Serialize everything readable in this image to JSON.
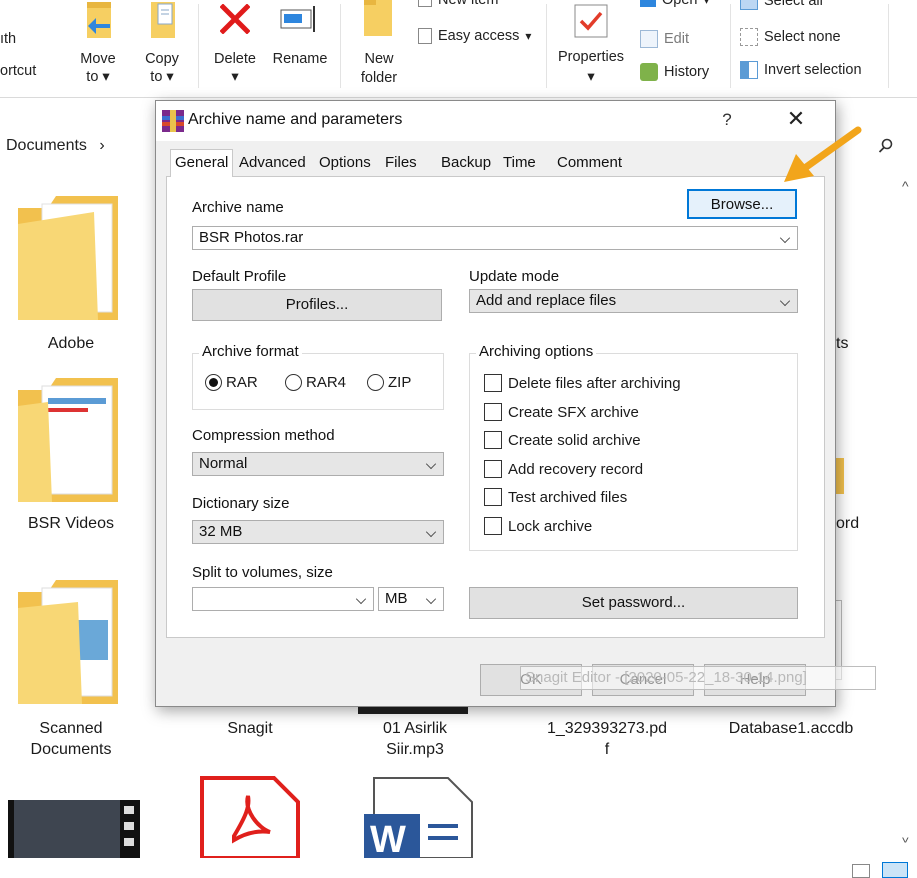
{
  "ribbon": {
    "path_label": "ıth",
    "shortcut_label": "ortcut",
    "move_to": [
      "Move",
      "to"
    ],
    "copy_to": [
      "Copy",
      "to"
    ],
    "delete": "Delete",
    "rename": "Rename",
    "new_folder": [
      "New",
      "folder"
    ],
    "new_item": "New item",
    "easy_access": "Easy access",
    "properties": "Properties",
    "open": "Open",
    "edit": "Edit",
    "history": "History",
    "select_all": "Select all",
    "select_none": "Select none",
    "invert_selection": "Invert selection"
  },
  "address": {
    "crumb": "Documents",
    "chevron": "›"
  },
  "files": {
    "adobe": "Adobe",
    "bsr_videos": "BSR Videos",
    "scanned": [
      "Scanned",
      "Documents"
    ],
    "snagit": "Snagit",
    "mp3": [
      "01 Asirlik",
      "Siir.mp3"
    ],
    "pdf": [
      "1_329393273.pd",
      "f"
    ],
    "accdb": "Database1.accdb",
    "partial_ts": "ts",
    "partial_ord": "ord"
  },
  "dialog": {
    "title": "Archive name and parameters",
    "help": "?",
    "close": "✕",
    "tabs": [
      "General",
      "Advanced",
      "Options",
      "Files",
      "Backup",
      "Time",
      "Comment"
    ],
    "archive_name_label": "Archive name",
    "browse": "Browse...",
    "archive_name_value": "BSR Photos.rar",
    "default_profile_label": "Default Profile",
    "profiles_button": "Profiles...",
    "update_mode_label": "Update mode",
    "update_mode_value": "Add and replace files",
    "archive_format_label": "Archive format",
    "formats": [
      "RAR",
      "RAR4",
      "ZIP"
    ],
    "selected_format": "RAR",
    "compression_label": "Compression method",
    "compression_value": "Normal",
    "dictionary_label": "Dictionary size",
    "dictionary_value": "32 MB",
    "split_label": "Split to volumes, size",
    "split_value": "",
    "split_unit": "MB",
    "archiving_options_label": "Archiving options",
    "options": [
      "Delete files after archiving",
      "Create SFX archive",
      "Create solid archive",
      "Add recovery record",
      "Test archived files",
      "Lock archive"
    ],
    "set_password": "Set password...",
    "ok": "OK",
    "cancel": "Cancel",
    "help_button": "Help"
  },
  "snagit_tooltip": "Snagit Editor - [2020-05-22_18-30-14.png]",
  "colors": {
    "accent": "#0078d7",
    "folder": "#f6cf62",
    "arrow": "#f2a51b"
  }
}
